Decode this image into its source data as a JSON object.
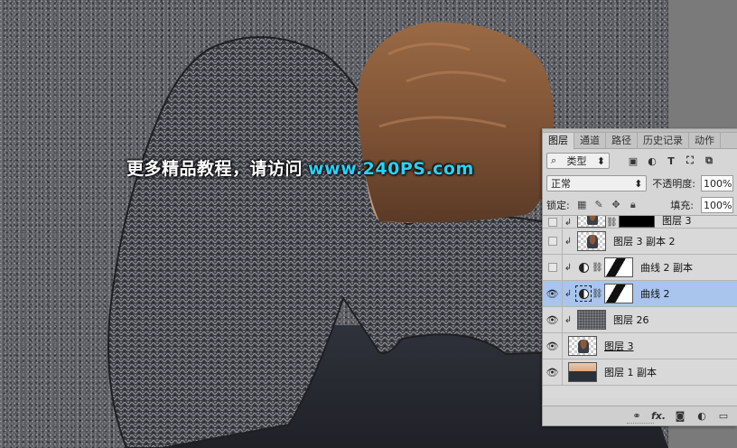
{
  "watermark": {
    "text": "更多精品教程，请访问",
    "url": "www.240PS.com"
  },
  "panel": {
    "tabs": [
      {
        "label": "图层"
      },
      {
        "label": "通道"
      },
      {
        "label": "路径"
      },
      {
        "label": "历史记录"
      },
      {
        "label": "动作"
      }
    ],
    "filter": {
      "kind_label": "类型",
      "icons": [
        "image-filter-icon",
        "adjustment-filter-icon",
        "type-filter-icon",
        "shape-filter-icon",
        "smart-object-filter-icon"
      ]
    },
    "blend": {
      "mode": "正常",
      "opacity_label": "不透明度:",
      "opacity_value": "100%"
    },
    "lock": {
      "label": "锁定:",
      "fill_label": "填充:",
      "fill_value": "100%"
    },
    "layers": [
      {
        "name": "图层 3",
        "visible": false,
        "type": "partial"
      },
      {
        "name": "图层 3 副本 2",
        "visible": false,
        "type": "pixel"
      },
      {
        "name": "曲线 2 副本",
        "visible": false,
        "type": "adjustment"
      },
      {
        "name": "曲线 2",
        "visible": true,
        "type": "adjustment",
        "selected": true
      },
      {
        "name": "图层 26",
        "visible": true,
        "type": "texture"
      },
      {
        "name": "图层 3",
        "visible": true,
        "type": "pixel"
      },
      {
        "name": "图层 1 副本",
        "visible": true,
        "type": "photo"
      }
    ],
    "footer_icons": [
      "link-icon",
      "fx-icon",
      "mask-icon",
      "adjustment-icon",
      "folder-icon"
    ],
    "footer_fx": "fx."
  },
  "colors": {
    "selected_row": "#a9c5ee",
    "watermark_url": "#2ad1f5"
  }
}
